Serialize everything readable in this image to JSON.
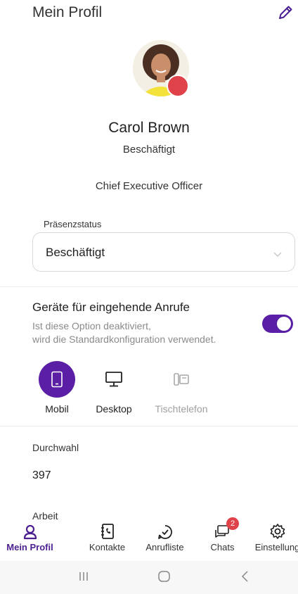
{
  "header": {
    "title": "Mein Profil",
    "edit_icon": "pencil-icon"
  },
  "profile": {
    "name": "Carol Brown",
    "status": "Beschäftigt",
    "role": "Chief Executive Officer",
    "status_dot_color": "#e0424a"
  },
  "presence": {
    "label": "Präsenzstatus",
    "selected": "Beschäftigt"
  },
  "incoming_calls": {
    "title": "Geräte für eingehende Anrufe",
    "desc_line1": "Ist diese Option deaktiviert,",
    "desc_line2": "wird die Standardkonfiguration verwendet.",
    "enabled": true,
    "accent_color": "#5b1fa5"
  },
  "devices": [
    {
      "label": "Mobil",
      "icon": "mobile-phone-icon",
      "selected": true
    },
    {
      "label": "Desktop",
      "icon": "desktop-monitor-icon",
      "selected": false
    },
    {
      "label": "Tischtelefon",
      "icon": "desk-phone-icon",
      "selected": false,
      "disabled": true
    }
  ],
  "fields": {
    "extension_label": "Durchwahl",
    "extension_value": "397",
    "work_label": "Arbeit"
  },
  "nav": [
    {
      "label": "Mein Profil",
      "icon": "person-icon",
      "active": true
    },
    {
      "label": "Kontakte",
      "icon": "contacts-book-icon"
    },
    {
      "label": "Anrufliste",
      "icon": "call-history-icon"
    },
    {
      "label": "Chats",
      "icon": "chat-bubble-icon",
      "badge": "2"
    },
    {
      "label": "Einstellung",
      "icon": "gear-icon"
    }
  ],
  "system_nav": [
    "recent-apps-icon",
    "home-icon",
    "back-icon"
  ]
}
